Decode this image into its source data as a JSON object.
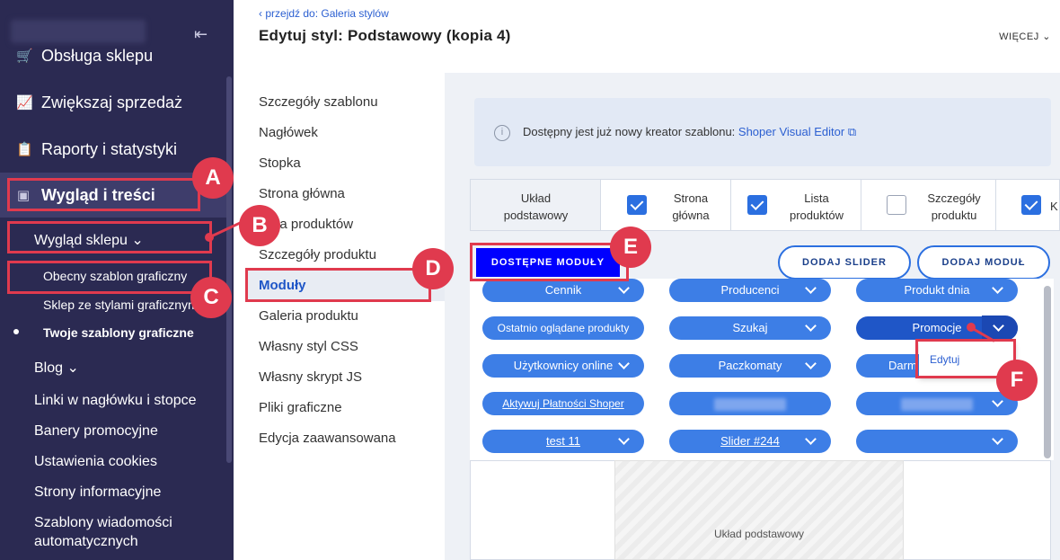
{
  "sidebar": {
    "items": [
      {
        "label": "Obsługa sklepu",
        "icon": "cart-icon"
      },
      {
        "label": "Zwiększaj sprzedaż",
        "icon": "chart-icon"
      },
      {
        "label": "Raporty i statystyki",
        "icon": "clipboard-icon"
      },
      {
        "label": "Wygląd i treści",
        "icon": "image-icon"
      }
    ],
    "sub": {
      "wyglad_sklepu": "Wygląd sklepu",
      "obecny": "Obecny szablon graficzny",
      "sklep_style": "Sklep ze stylami graficznymi",
      "twoje": "Twoje szablony graficzne",
      "blog": "Blog",
      "linki": "Linki w nagłówku i stopce",
      "banery": "Banery promocyjne",
      "cookies": "Ustawienia cookies",
      "strony": "Strony informacyjne",
      "szablony1": "Szablony wiadomości",
      "szablony2": "automatycznych"
    }
  },
  "header": {
    "back": "przejdź do: Galeria stylów",
    "title": "Edytuj styl: Podstawowy (kopia 4)",
    "more": "WIĘCEJ"
  },
  "menu": [
    "Szczegóły szablonu",
    "Nagłówek",
    "Stopka",
    "Strona główna",
    "Lista produktów",
    "Szczegóły produktu",
    "Moduły",
    "Galeria produktu",
    "Własny styl CSS",
    "Własny skrypt JS",
    "Pliki graficzne",
    "Edycja zaawansowana"
  ],
  "notice": {
    "text": "Dostępny jest już nowy kreator szablonu: ",
    "link": "Shoper Visual Editor"
  },
  "tabs": {
    "t1": "Układ",
    "t1b": "podstawowy",
    "t2": "Strona",
    "t2b": "główna",
    "t3": "Lista",
    "t3b": "produktów",
    "t4": "Szczegóły",
    "t4b": "produktu",
    "t5": "K"
  },
  "buttons": {
    "dostepne": "DOSTĘPNE MODUŁY",
    "slider": "DODAJ SLIDER",
    "modul": "DODAJ MODUŁ"
  },
  "modules": {
    "m1": "Cennik",
    "m2": "Producenci",
    "m3": "Produkt dnia",
    "m4": "Ostatnio oglądane produkty",
    "m5": "Szukaj",
    "m6": "Promocje",
    "m7": "Użytkownicy online",
    "m8": "Paczkomaty",
    "m9": "Darm",
    "m10": "Aktywuj Płatności Shoper",
    "m13": "test 11",
    "m14": "Slider #244"
  },
  "dropdown": {
    "edit": "Edytuj"
  },
  "layout_label": "Układ podstawowy",
  "annotations": {
    "a": "A",
    "b": "B",
    "c": "C",
    "d": "D",
    "e": "E",
    "f": "F"
  }
}
